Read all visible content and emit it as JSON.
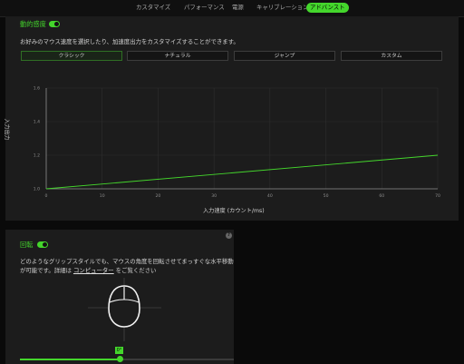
{
  "tabs": [
    {
      "label": "カスタマイズ",
      "active": false
    },
    {
      "label": "パフォーマンス",
      "active": false
    },
    {
      "label": "電源",
      "active": false
    },
    {
      "label": "キャリブレーション",
      "active": false
    },
    {
      "label": "アドバンスト",
      "active": true
    }
  ],
  "accel": {
    "title": "動的感度",
    "enabled": true,
    "description": "お好みのマウス速度を選択したり、加速度出力をカスタマイズすることができます。",
    "presets": [
      {
        "label": "クラシック",
        "selected": true
      },
      {
        "label": "ナチュラル",
        "selected": false
      },
      {
        "label": "ジャンプ",
        "selected": false
      },
      {
        "label": "カスタム",
        "selected": false
      }
    ]
  },
  "chart_data": {
    "type": "line",
    "xlabel": "入力速度 (カウント/ms)",
    "ylabel": "入力出力",
    "xlim": [
      0,
      70
    ],
    "ylim": [
      1.0,
      1.6
    ],
    "xticks": [
      "0",
      "10",
      "20",
      "30",
      "40",
      "50",
      "60",
      "70"
    ],
    "yticks": [
      "1.0",
      "1.2",
      "1.4",
      "1.6"
    ],
    "grid": true,
    "series": [
      {
        "x": [
          0,
          70
        ],
        "y": [
          1.0,
          1.2
        ]
      }
    ],
    "colors": {
      "line": "#44d62c",
      "grid": "#2e2e2e",
      "axis": "#8f8f8f"
    }
  },
  "rotation": {
    "title": "回転",
    "enabled": true,
    "help_label": "?",
    "desc_line1": "どのようなグリップスタイルでも、マウスの角度を回転させてまっすぐな水平移動",
    "desc_line2_prefix": "が可能です。詳細は",
    "desc_link": "コンピューター",
    "desc_line2_suffix": "をご覧ください",
    "angle_value": "0°",
    "slider_fraction": 0.47
  },
  "colors": {
    "accent": "#44d62c",
    "panel": "#1c1c1c",
    "background": "#0a0a0a"
  }
}
